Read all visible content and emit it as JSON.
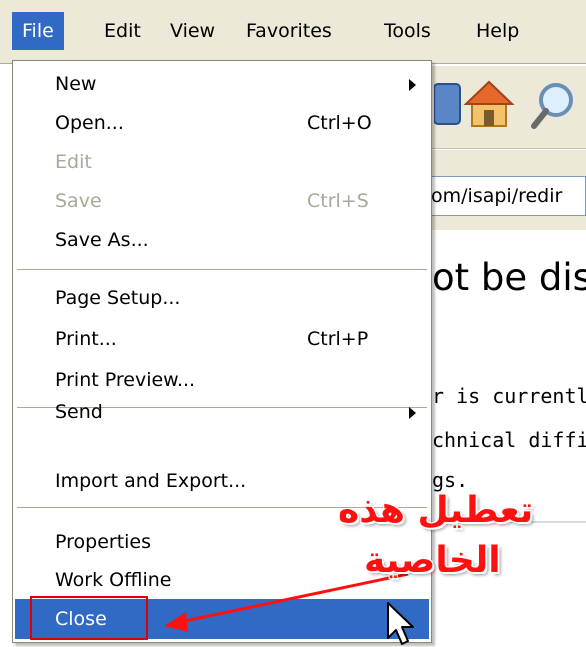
{
  "menubar": {
    "items": [
      {
        "label": "File"
      },
      {
        "label": "Edit"
      },
      {
        "label": "View"
      },
      {
        "label": "Favorites"
      },
      {
        "label": "Tools"
      },
      {
        "label": "Help"
      }
    ]
  },
  "background": {
    "address_text": "om/isapi/redir",
    "heading": "ot be dis",
    "body_lines": [
      "r is currently",
      "chnical diffi",
      "gs."
    ]
  },
  "file_menu": {
    "items": [
      {
        "label": "New",
        "shortcut": "",
        "has_submenu": true,
        "disabled": false
      },
      {
        "label": "Open...",
        "shortcut": "Ctrl+O",
        "disabled": false
      },
      {
        "label": "Edit",
        "shortcut": "",
        "disabled": true
      },
      {
        "label": "Save",
        "shortcut": "Ctrl+S",
        "disabled": true
      },
      {
        "label": "Save As...",
        "shortcut": "",
        "disabled": false
      },
      {
        "label": "Page Setup...",
        "shortcut": "",
        "disabled": false
      },
      {
        "label": "Print...",
        "shortcut": "Ctrl+P",
        "disabled": false
      },
      {
        "label": "Print Preview...",
        "shortcut": "",
        "disabled": false
      },
      {
        "label": "Send",
        "shortcut": "",
        "has_submenu": true,
        "disabled": false
      },
      {
        "label": "Import and Export...",
        "shortcut": "",
        "disabled": false
      },
      {
        "label": "Properties",
        "shortcut": "",
        "disabled": false
      },
      {
        "label": "Work Offline",
        "shortcut": "",
        "disabled": false
      },
      {
        "label": "Close",
        "shortcut": "",
        "selected": true,
        "disabled": false
      }
    ]
  },
  "annotation": {
    "line1": "تعطيل هذه",
    "line2": "الخاصية",
    "color": "#ff1010"
  },
  "colors": {
    "selection": "#316ac5",
    "menubar_bg": "#ece9d8",
    "disabled_text": "#aca899"
  }
}
